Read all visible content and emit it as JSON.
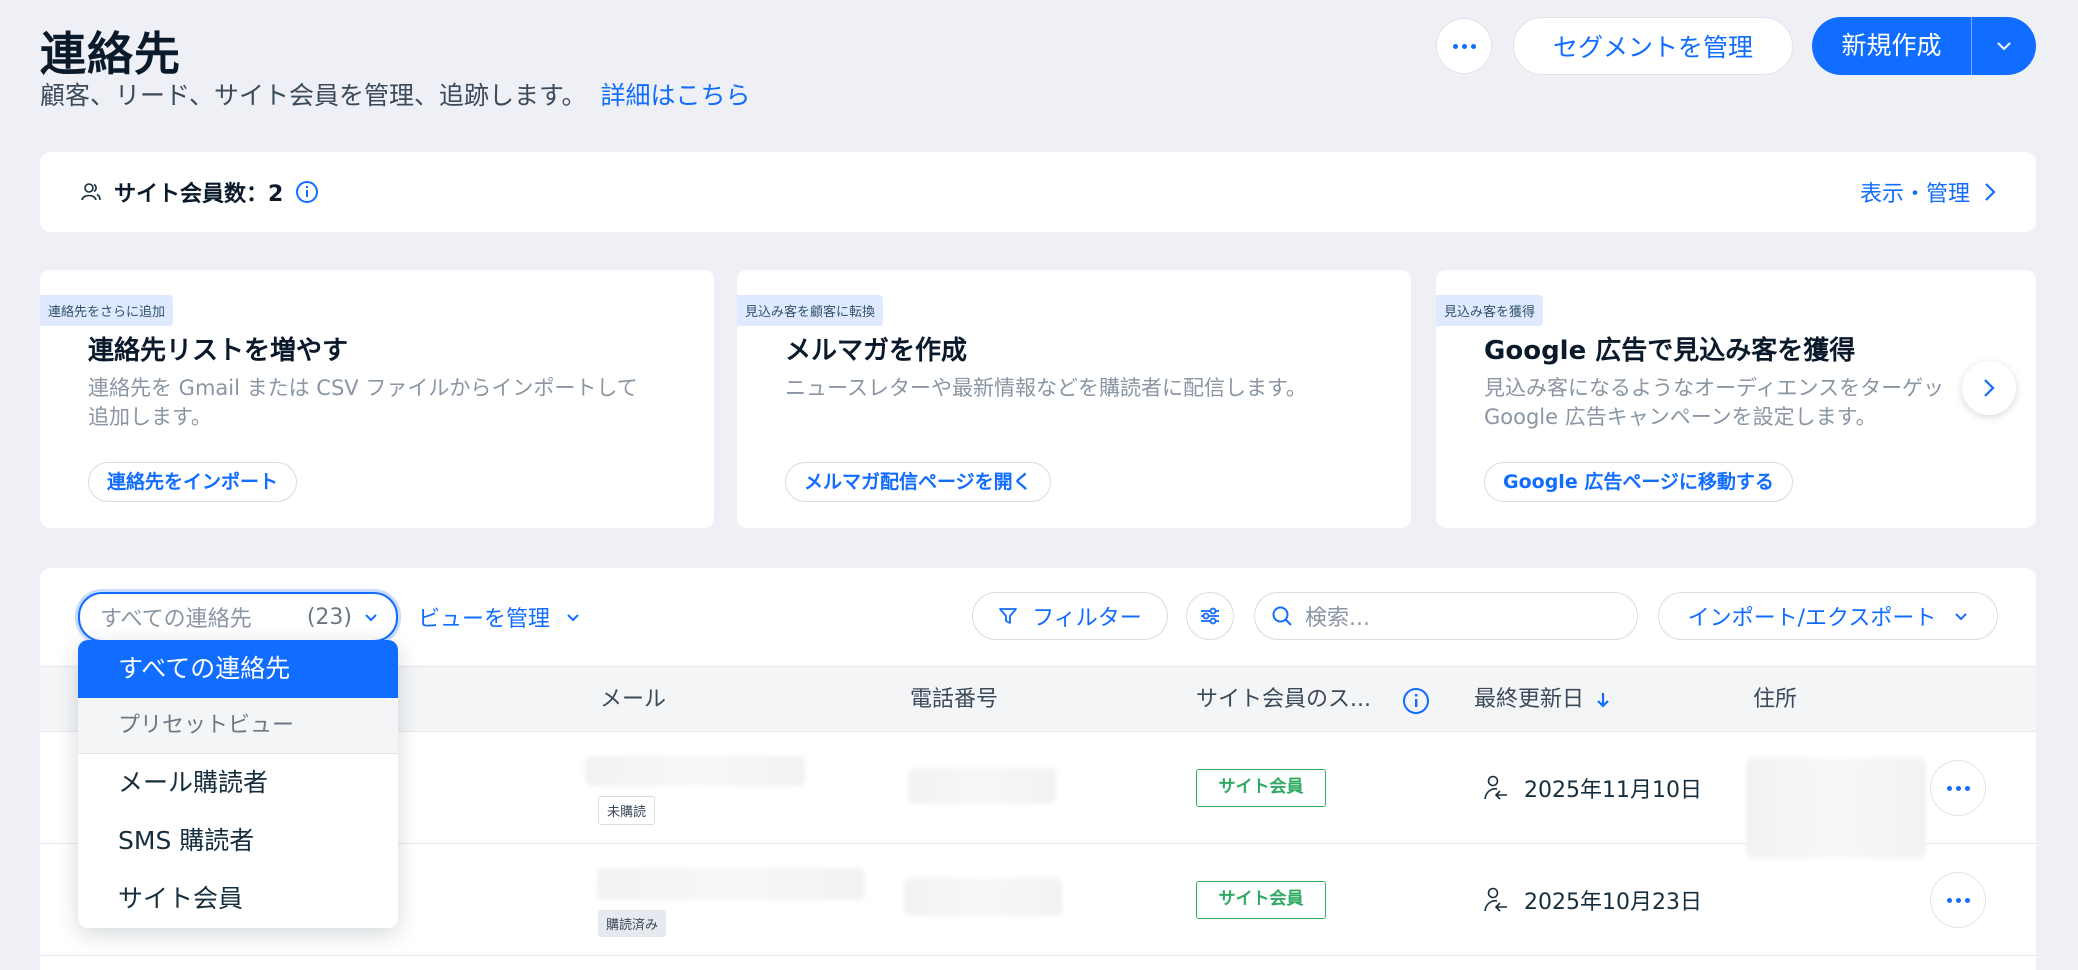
{
  "header": {
    "title": "連絡先",
    "subtitle": "顧客、リード、サイト会員を管理、追跡します。",
    "learn_more": "詳細はこちら",
    "segment_button": "セグメントを管理",
    "new_button": "新規作成"
  },
  "member_strip": {
    "label": "サイト会員数：2",
    "action": "表示・管理"
  },
  "cards": [
    {
      "tag": "連絡先をさらに追加",
      "title": "連絡先リストを増やす",
      "description": "連絡先を Gmail または CSV ファイルからインポートして\n追加します。",
      "cta": "連絡先をインポート"
    },
    {
      "tag": "見込み客を顧客に転換",
      "title": "メルマガを作成",
      "description": "ニュースレターや最新情報などを購読者に配信します。",
      "cta": "メルマガ配信ページを開く"
    },
    {
      "tag": "見込み客を獲得",
      "title": "Google 広告で見込み客を獲得",
      "description": "見込み客になるようなオーディエンスをターゲッ\nGoogle 広告キャンペーンを設定します。",
      "cta": "Google 広告ページに移動する"
    }
  ],
  "toolbar": {
    "view_select_value": "すべての連絡先",
    "view_select_count": "(23)",
    "manage_views": "ビューを管理",
    "filter": "フィルター",
    "search_placeholder": "検索...",
    "import_export": "インポート/エクスポート"
  },
  "table": {
    "columns": [
      "メール",
      "電話番号",
      "サイト会員のス...",
      "最終更新日",
      "住所"
    ],
    "rows": [
      {
        "subscription": "未購読",
        "member_status": "サイト会員",
        "updated": "2025年11月10日"
      },
      {
        "subscription": "購読済み",
        "member_status": "サイト会員",
        "updated": "2025年10月23日"
      }
    ]
  },
  "dropdown": {
    "selected": "すべての連絡先",
    "section": "プリセットビュー",
    "items": [
      "メール購読者",
      "SMS 購読者",
      "サイト会員"
    ]
  },
  "colors": {
    "accent": "#116dff",
    "member_green": "#2faa63",
    "background": "#eef0f5"
  }
}
